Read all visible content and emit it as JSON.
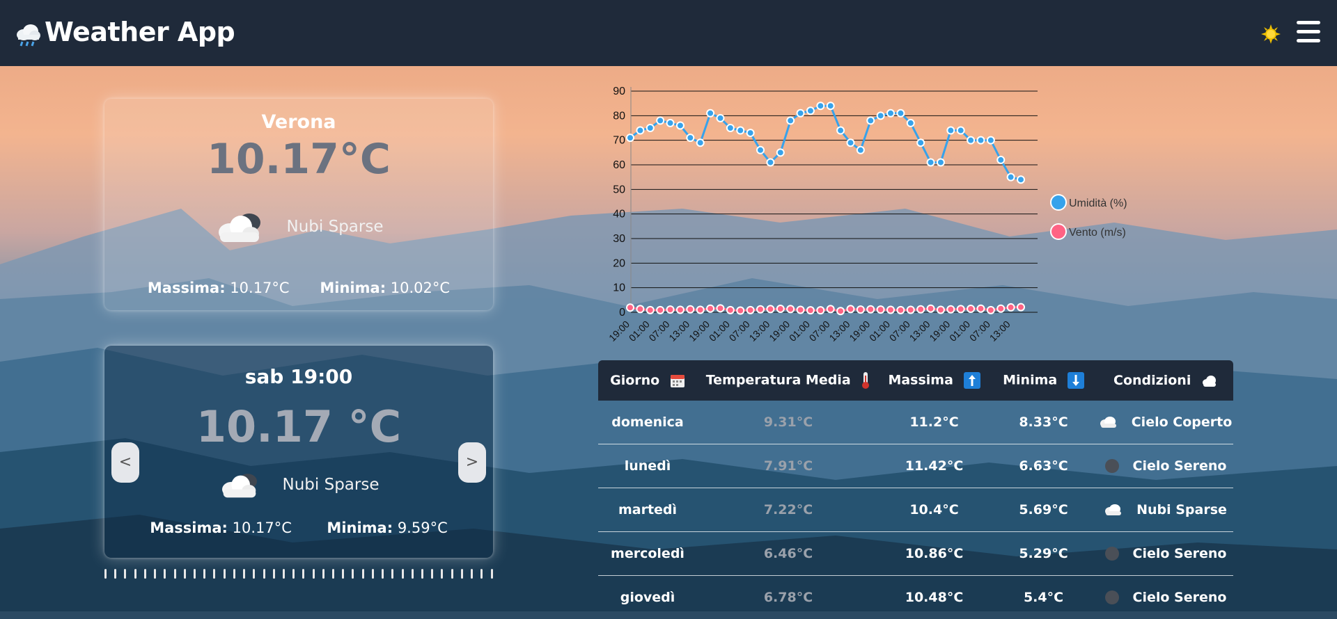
{
  "header": {
    "title": "Weather App"
  },
  "current": {
    "city": "Verona",
    "temp": "10.17°C",
    "condition": "Nubi Sparse",
    "max_label": "Massima:",
    "max_value": "10.17°C",
    "min_label": "Minima:",
    "min_value": "10.02°C"
  },
  "hourly": {
    "day_time": "sab 19:00",
    "temp": "10.17 °C",
    "condition": "Nubi Sparse",
    "max_label": "Massima:",
    "max_value": "10.17°C",
    "min_label": "Minima:",
    "min_value": "9.59°C",
    "prev_label": "<",
    "next_label": ">"
  },
  "table": {
    "headers": [
      "Giorno",
      "Temperatura Media",
      "Massima",
      "Minima",
      "Condizioni"
    ],
    "rows": [
      {
        "day": "domenica",
        "avg": "9.31°C",
        "max": "11.2°C",
        "min": "8.33°C",
        "cond": "Cielo Coperto",
        "icon": "cloud"
      },
      {
        "day": "lunedì",
        "avg": "7.91°C",
        "max": "11.42°C",
        "min": "6.63°C",
        "cond": "Cielo Sereno",
        "icon": "clear"
      },
      {
        "day": "martedì",
        "avg": "7.22°C",
        "max": "10.4°C",
        "min": "5.69°C",
        "cond": "Nubi Sparse",
        "icon": "cloud"
      },
      {
        "day": "mercoledì",
        "avg": "6.46°C",
        "max": "10.86°C",
        "min": "5.29°C",
        "cond": "Cielo Sereno",
        "icon": "clear"
      },
      {
        "day": "giovedì",
        "avg": "6.78°C",
        "max": "10.48°C",
        "min": "5.4°C",
        "cond": "Cielo Sereno",
        "icon": "clear"
      }
    ]
  },
  "chart_data": {
    "type": "line",
    "ylim": [
      0,
      90
    ],
    "yticks": [
      0,
      10,
      20,
      30,
      40,
      50,
      60,
      70,
      80,
      90
    ],
    "xtick_labels": [
      "19:00",
      "01:00",
      "07:00",
      "13:00",
      "19:00",
      "01:00",
      "07:00",
      "13:00",
      "19:00",
      "01:00",
      "07:00",
      "13:00",
      "19:00",
      "01:00",
      "07:00",
      "13:00",
      "19:00",
      "01:00",
      "07:00",
      "13:00"
    ],
    "grid": true,
    "legend_position": "right",
    "series": [
      {
        "name": "Umidità (%)",
        "color": "#36a2eb",
        "values": [
          71,
          74,
          75,
          78,
          77,
          76,
          71,
          69,
          81,
          79,
          75,
          74,
          73,
          66,
          61,
          65,
          78,
          81,
          82,
          84,
          84,
          74,
          69,
          66,
          78,
          80,
          81,
          81,
          77,
          69,
          61,
          61,
          74,
          74,
          70,
          70,
          70,
          62,
          55,
          54
        ]
      },
      {
        "name": "Vento (m/s)",
        "color": "#ff6384",
        "values": [
          1.9,
          1.3,
          0.9,
          0.9,
          1.1,
          1.0,
          1.2,
          1.0,
          1.5,
          1.6,
          0.9,
          0.7,
          0.9,
          1.2,
          1.3,
          1.4,
          1.3,
          1.0,
          0.8,
          0.8,
          1.3,
          0.5,
          1.3,
          1.1,
          1.2,
          1.1,
          1.0,
          0.9,
          1.0,
          1.2,
          1.5,
          1.0,
          1.2,
          1.3,
          1.4,
          1.5,
          0.9,
          1.5,
          2.0,
          2.1
        ]
      }
    ]
  }
}
